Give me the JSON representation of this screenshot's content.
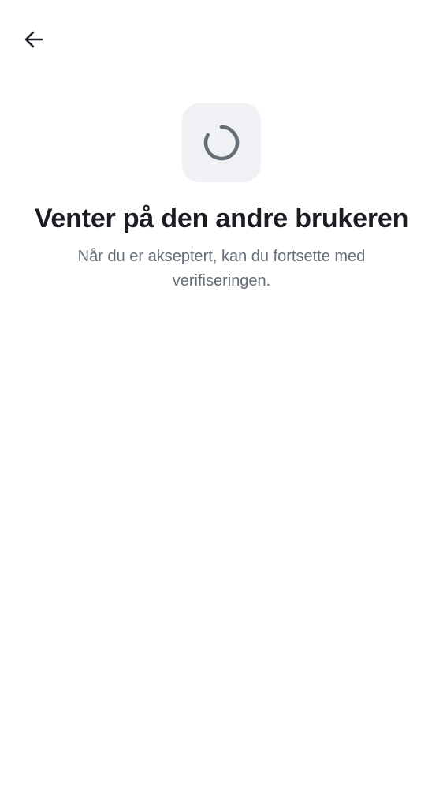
{
  "header": {
    "back_icon": "arrow-left-icon"
  },
  "status": {
    "icon": "loading-spinner-icon",
    "title": "Venter på den andre brukeren",
    "subtitle": "Når du er akseptert, kan du fortsette med verifiseringen."
  },
  "colors": {
    "background": "#ffffff",
    "title": "#1b1d22",
    "subtitle": "#656d77",
    "spinner": "#656d77",
    "spinner_tile": "#f0f1f5"
  }
}
